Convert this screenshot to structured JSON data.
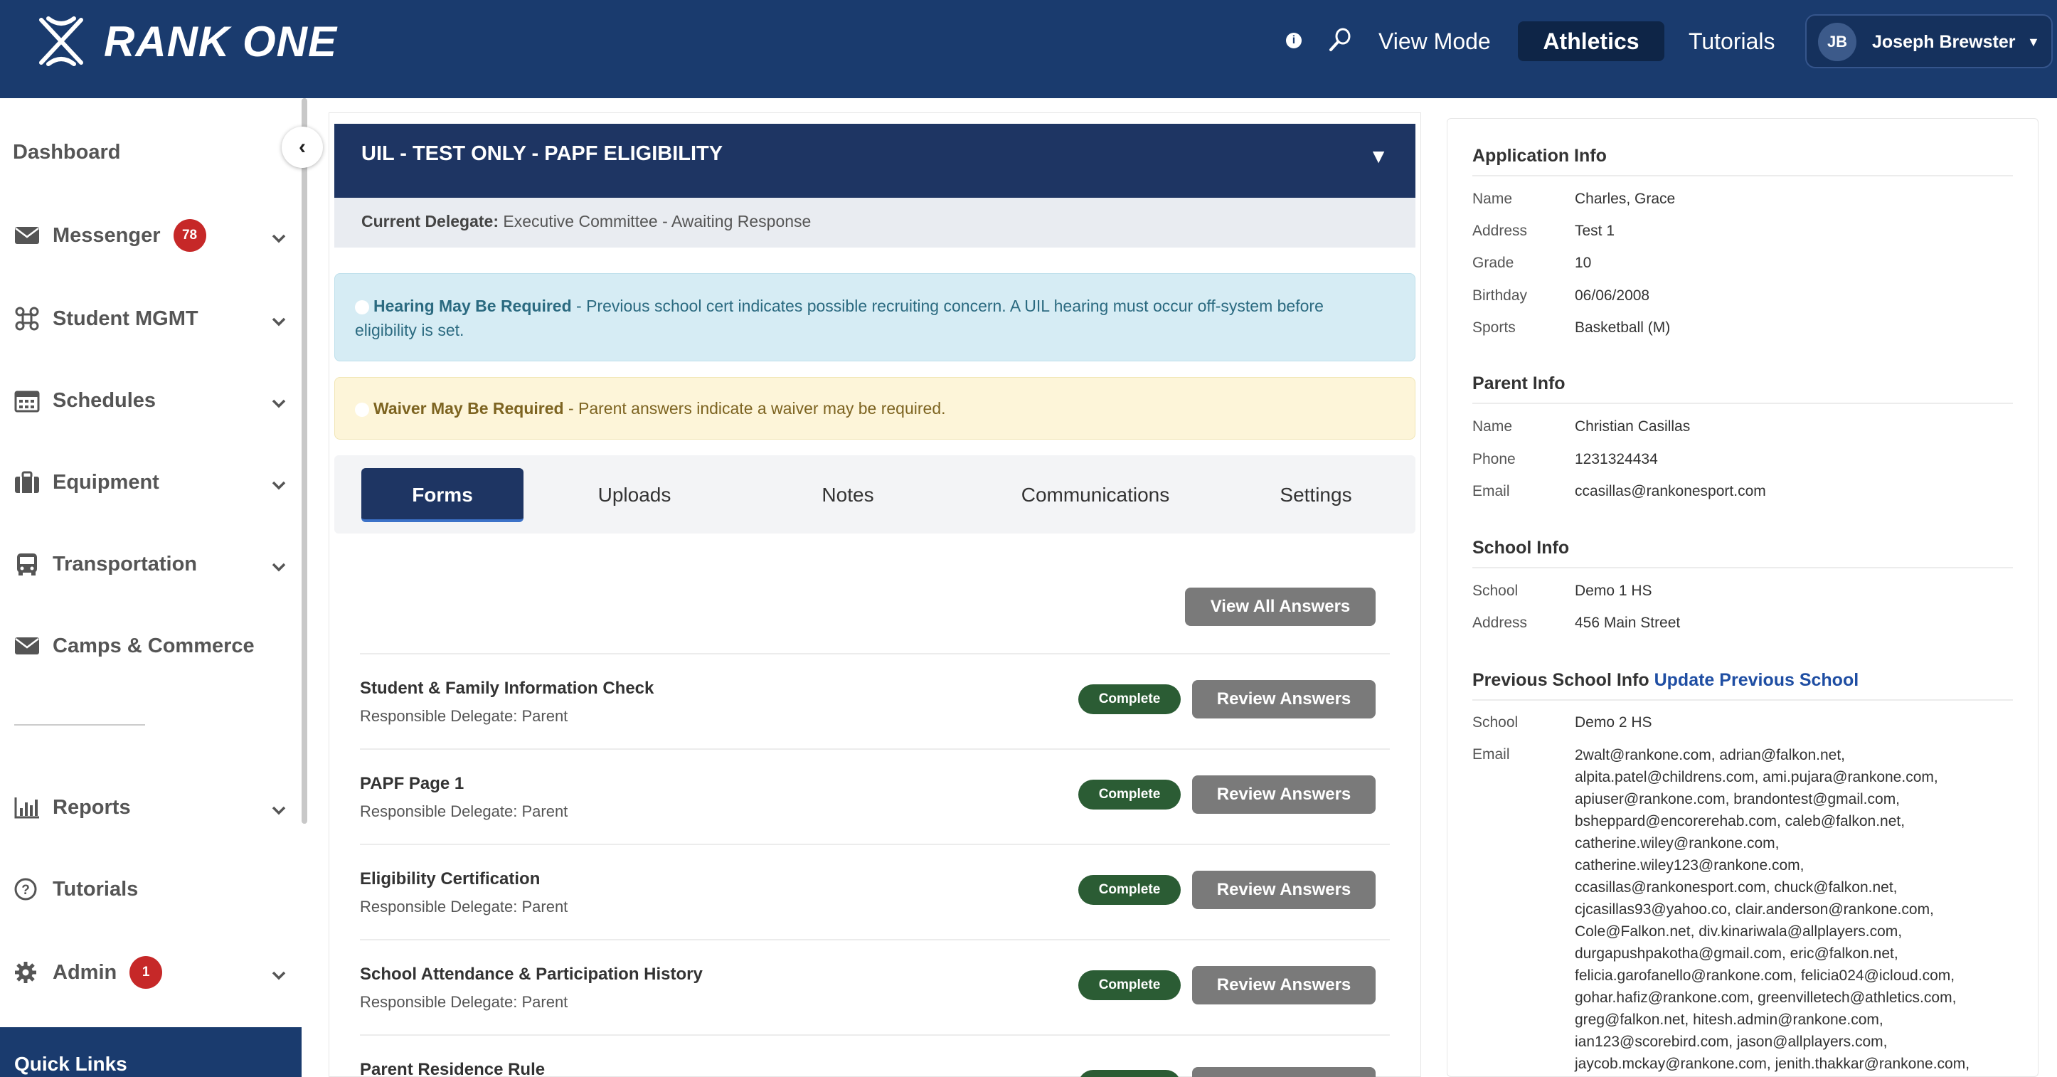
{
  "header": {
    "logo_text": "RANK ONE",
    "view_mode": "View Mode",
    "athletics": "Athletics",
    "tutorials": "Tutorials",
    "user_initials": "JB",
    "user_name": "Joseph Brewster"
  },
  "sidebar": {
    "dashboard": "Dashboard",
    "items": [
      {
        "label": "Messenger",
        "icon": "envelope-icon",
        "badge": "78"
      },
      {
        "label": "Student MGMT",
        "icon": "command-icon"
      },
      {
        "label": "Schedules",
        "icon": "calendar-icon"
      },
      {
        "label": "Equipment",
        "icon": "briefcase-icon"
      },
      {
        "label": "Transportation",
        "icon": "bus-icon"
      },
      {
        "label": "Camps & Commerce",
        "icon": "envelope-icon"
      },
      {
        "label": "Reports",
        "icon": "bar-chart-icon"
      },
      {
        "label": "Tutorials",
        "icon": "question-circle-icon"
      },
      {
        "label": "Admin",
        "icon": "gear-icon",
        "badge": "1"
      }
    ],
    "quick_links": "Quick Links"
  },
  "application": {
    "title": "UIL - TEST ONLY - PAPF ELIGIBILITY",
    "delegate_label": "Current Delegate:",
    "delegate_value": "Executive Committee - Awaiting Response",
    "hearing_title": "Hearing May Be Required",
    "hearing_text": " - Previous school cert indicates possible recruiting concern. A UIL hearing must occur off-system before eligibility is set.",
    "waiver_title": "Waiver May Be Required",
    "waiver_text": " - Parent answers indicate a waiver may be required."
  },
  "tabs": [
    "Forms",
    "Uploads",
    "Notes",
    "Communications",
    "Settings"
  ],
  "forms": {
    "view_all": "View All Answers",
    "status": "Complete",
    "review": "Review Answers",
    "rows": [
      {
        "name": "Student & Family Information Check",
        "delegate": "Responsible Delegate: Parent"
      },
      {
        "name": "PAPF Page 1",
        "delegate": "Responsible Delegate: Parent"
      },
      {
        "name": "Eligibility Certification",
        "delegate": "Responsible Delegate: Parent"
      },
      {
        "name": "School Attendance & Participation History",
        "delegate": "Responsible Delegate: Parent"
      },
      {
        "name": "Parent Residence Rule",
        "delegate": ""
      }
    ]
  },
  "info": {
    "app_title": "Application Info",
    "app": [
      {
        "k": "Name",
        "v": "Charles, Grace"
      },
      {
        "k": "Address",
        "v": "Test 1"
      },
      {
        "k": "Grade",
        "v": "10"
      },
      {
        "k": "Birthday",
        "v": "06/06/2008"
      },
      {
        "k": "Sports",
        "v": "Basketball (M)"
      }
    ],
    "parent_title": "Parent Info",
    "parent": [
      {
        "k": "Name",
        "v": "Christian Casillas"
      },
      {
        "k": "Phone",
        "v": "1231324434"
      },
      {
        "k": "Email",
        "v": "ccasillas@rankonesport.com"
      }
    ],
    "school_title": "School Info",
    "school": [
      {
        "k": "School",
        "v": "Demo 1 HS"
      },
      {
        "k": "Address",
        "v": "456 Main Street"
      }
    ],
    "prev_title": "Previous School Info",
    "prev_link": "Update Previous School",
    "prev_school_k": "School",
    "prev_school_v": "Demo 2 HS",
    "prev_email_k": "Email",
    "prev_emails": [
      "2walt@rankone.com, adrian@falkon.net,",
      "alpita.patel@childrens.com, ami.pujara@rankone.com,",
      "apiuser@rankone.com, brandontest@gmail.com,",
      "bsheppard@encorerehab.com, caleb@falkon.net,",
      "catherine.wiley@rankone.com,",
      "catherine.wiley123@rankone.com,",
      "ccasillas@rankonesport.com, chuck@falkon.net,",
      "cjcasillas93@yahoo.co, clair.anderson@rankone.com,",
      "Cole@Falkon.net, div.kinariwala@allplayers.com,",
      "durgapushpakotha@gmail.com, eric@falkon.net,",
      "felicia.garofanello@rankone.com, felicia024@icloud.com,",
      "gohar.hafiz@rankone.com, greenvilletech@athletics.com,",
      "greg@falkon.net, hitesh.admin@rankone.com,",
      "ian123@scorebird.com, jason@allplayers.com,",
      "jaycob.mckay@rankone.com, jenith.thakkar@rankone.com,"
    ]
  }
}
